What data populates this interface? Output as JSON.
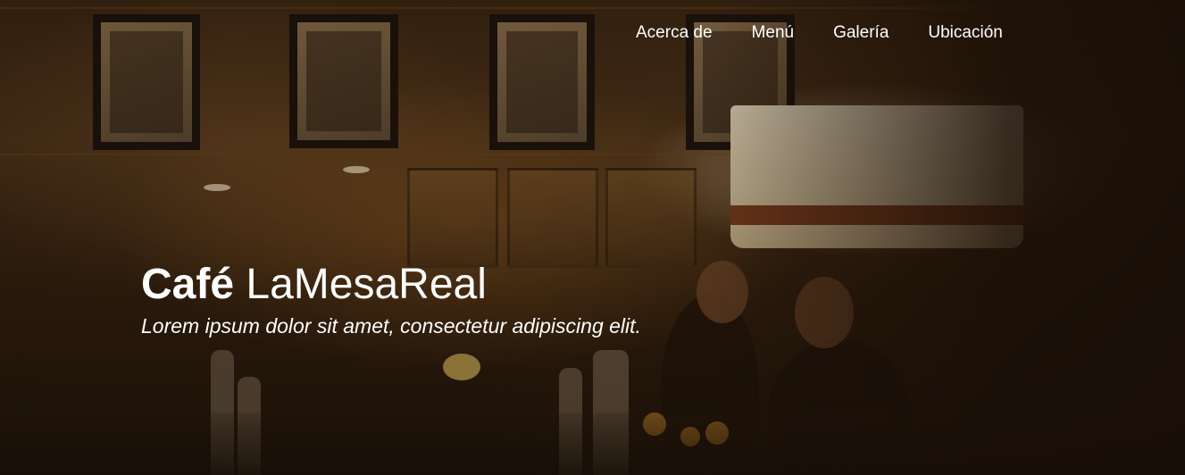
{
  "nav": {
    "items": [
      {
        "label": "Acerca de"
      },
      {
        "label": "Menú"
      },
      {
        "label": "Galería"
      },
      {
        "label": "Ubicación"
      }
    ]
  },
  "hero": {
    "brand_bold": "Café",
    "brand_light": "LaMesaReal",
    "tagline": "Lorem ipsum dolor sit amet, consectetur adipiscing elit."
  }
}
